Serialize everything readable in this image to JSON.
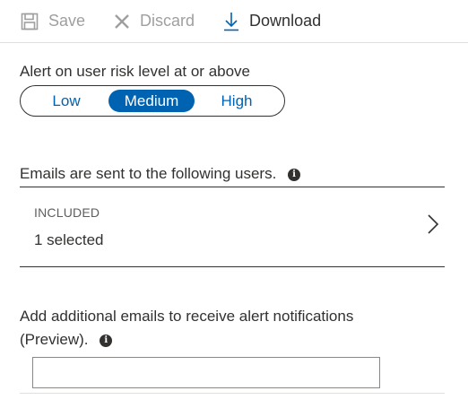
{
  "toolbar": {
    "save_label": "Save",
    "discard_label": "Discard",
    "download_label": "Download"
  },
  "risk": {
    "label": "Alert on user risk level at or above",
    "options": [
      "Low",
      "Medium",
      "High"
    ],
    "selected": "Medium"
  },
  "emails": {
    "label": "Emails are sent to the following users.",
    "included_caption": "INCLUDED",
    "included_value": "1 selected"
  },
  "additional": {
    "label_line1": "Add additional emails to receive alert notifications",
    "label_line2": "(Preview).",
    "input_value": ""
  },
  "colors": {
    "accent": "#0063b1",
    "disabled": "#a19f9d",
    "text": "#323130"
  },
  "icons": {
    "save": "save-icon",
    "discard": "close-icon",
    "download": "download-icon",
    "info": "info-icon",
    "chevron": "chevron-right-icon"
  }
}
